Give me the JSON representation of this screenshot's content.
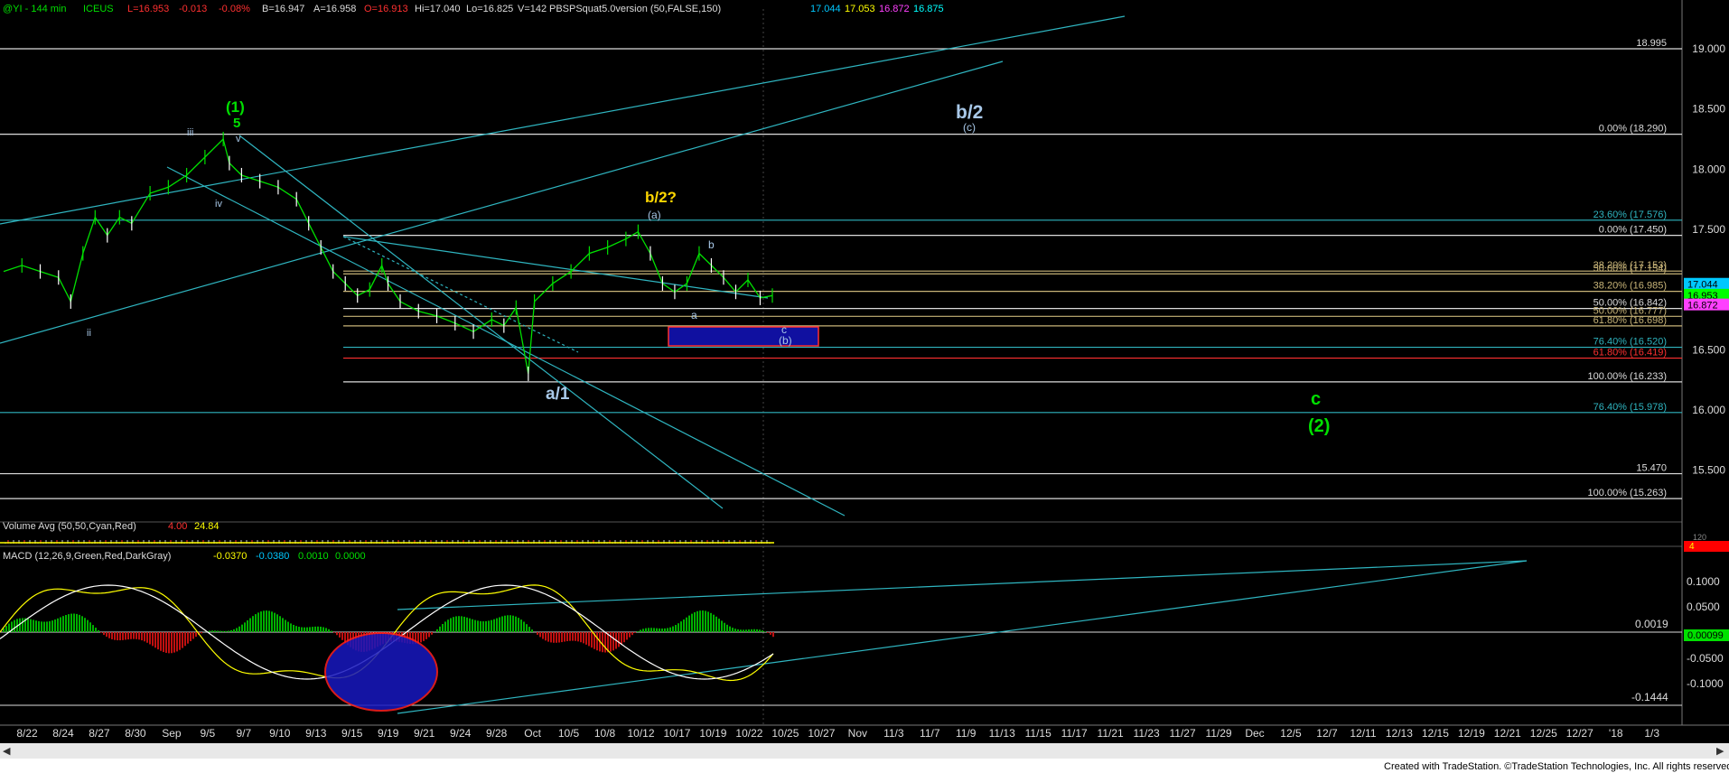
{
  "header": {
    "symbol": "@YI - 144 min",
    "exchange": "ICEUS",
    "last": "L=16.953",
    "change": "-0.013",
    "pct": "-0.08%",
    "bid": "B=16.947",
    "ask": "A=16.958",
    "open": "O=16.913",
    "hi": "Hi=17.040",
    "lo": "Lo=16.825",
    "vol": "V=142",
    "study": "PBSPSquat5.0version (50,FALSE,150)",
    "study_values": [
      "17.044",
      "17.053",
      "16.872",
      "16.875"
    ],
    "study_colors": [
      "#00c8ff",
      "#ffff00",
      "#ff40ff",
      "#00ffff"
    ]
  },
  "volume_panel": {
    "label": "Volume Avg (50,50,Cyan,Red)",
    "v1": "4.00",
    "v2": "24.84",
    "axis_labels": [
      "120",
      "4"
    ]
  },
  "macd_panel": {
    "label": "MACD (12,26,9,Green,Red,DarkGray)",
    "values": [
      "-0.0370",
      "-0.0380",
      "0.0010",
      "0.0000"
    ],
    "axis_labels": [
      "0.1000",
      "0.0500",
      "-0.0500",
      "-0.1000"
    ],
    "current": "0.00099",
    "hline_labels": [
      "0.0019",
      "-0.1444"
    ]
  },
  "footer": {
    "credit": "Created with TradeStation. ©TradeStation Technologies, Inc. All rights reserved."
  },
  "colors": {
    "background": "#000000",
    "grid": "#6e6e6e",
    "channel": "#2fb5c0",
    "bar_up": "#00e000",
    "bar_down": "#ffffff",
    "label_blue": "#a8c8e8",
    "label_green": "#00e000",
    "label_yellow": "#ffd700",
    "box_fill": "#1010a0",
    "box_border": "#ff3030"
  },
  "chart_data": {
    "type": "line",
    "title": "",
    "xlabel": "",
    "ylabel": "",
    "ylim": [
      15.1,
      19.3
    ],
    "x_ticks": [
      "8/22",
      "8/24",
      "8/27",
      "8/30",
      "Sep",
      "9/5",
      "9/7",
      "9/10",
      "9/13",
      "9/15",
      "9/19",
      "9/21",
      "9/24",
      "9/28",
      "Oct",
      "10/5",
      "10/8",
      "10/12",
      "10/17",
      "10/19",
      "10/22",
      "10/25",
      "10/27",
      "Nov",
      "11/3",
      "11/7",
      "11/9",
      "11/13",
      "11/15",
      "11/17",
      "11/21",
      "11/23",
      "11/27",
      "11/29",
      "Dec",
      "12/5",
      "12/7",
      "12/11",
      "12/13",
      "12/15",
      "12/19",
      "12/21",
      "12/25",
      "12/27",
      "'18",
      "1/3"
    ],
    "y_axis_labels": [
      "19.000",
      "18.500",
      "18.000",
      "17.500",
      "16.500",
      "16.000",
      "15.500"
    ],
    "price_series": {
      "name": "@YI",
      "points": [
        [
          0,
          17.15
        ],
        [
          3,
          17.2
        ],
        [
          6,
          17.15
        ],
        [
          9,
          17.1
        ],
        [
          11,
          16.9
        ],
        [
          13,
          17.3
        ],
        [
          15,
          17.6
        ],
        [
          17,
          17.45
        ],
        [
          19,
          17.6
        ],
        [
          21,
          17.55
        ],
        [
          24,
          17.8
        ],
        [
          27,
          17.85
        ],
        [
          30,
          17.95
        ],
        [
          33,
          18.1
        ],
        [
          36,
          18.25
        ],
        [
          37,
          18.05
        ],
        [
          39,
          17.95
        ],
        [
          42,
          17.9
        ],
        [
          45,
          17.85
        ],
        [
          48,
          17.75
        ],
        [
          50,
          17.55
        ],
        [
          52,
          17.35
        ],
        [
          54,
          17.15
        ],
        [
          56,
          17.05
        ],
        [
          58,
          16.95
        ],
        [
          60,
          17.0
        ],
        [
          62,
          17.2
        ],
        [
          63,
          17.05
        ],
        [
          65,
          16.9
        ],
        [
          68,
          16.82
        ],
        [
          71,
          16.78
        ],
        [
          74,
          16.72
        ],
        [
          77,
          16.65
        ],
        [
          80,
          16.75
        ],
        [
          82,
          16.7
        ],
        [
          84,
          16.85
        ],
        [
          86,
          16.3
        ],
        [
          87,
          16.9
        ],
        [
          90,
          17.05
        ],
        [
          93,
          17.15
        ],
        [
          96,
          17.3
        ],
        [
          99,
          17.35
        ],
        [
          102,
          17.42
        ],
        [
          104,
          17.48
        ],
        [
          106,
          17.3
        ],
        [
          108,
          17.05
        ],
        [
          110,
          16.98
        ],
        [
          112,
          17.05
        ],
        [
          114,
          17.3
        ],
        [
          116,
          17.2
        ],
        [
          118,
          17.1
        ],
        [
          120,
          16.98
        ],
        [
          122,
          17.08
        ],
        [
          124,
          16.93
        ],
        [
          126,
          16.95
        ]
      ],
      "x_range": [
        0,
        126
      ]
    },
    "fib_levels": [
      {
        "label": "18.995",
        "value": 19.0,
        "color": "#dcdcdc"
      },
      {
        "label": "0.00% (18.290)",
        "value": 18.29,
        "color": "#dcdcdc"
      },
      {
        "label": "23.60% (17.576)",
        "value": 17.576,
        "color": "#2fb5c0"
      },
      {
        "label": "0.00% (17.450)",
        "value": 17.45,
        "color": "#dcdcdc"
      },
      {
        "label": "38.20% (17.153)",
        "value": 17.153,
        "color": "#c8b478"
      },
      {
        "label": "50.00% (17.154)",
        "value": 17.13,
        "color": "#c8b478"
      },
      {
        "label": "38.20% (16.985)",
        "value": 16.985,
        "color": "#c8b478"
      },
      {
        "label": "50.00% (16.842)",
        "value": 16.842,
        "color": "#dcdcdc"
      },
      {
        "label": "50.00% (16.777)",
        "value": 16.777,
        "color": "#c8b478"
      },
      {
        "label": "61.80% (16.698)",
        "value": 16.698,
        "color": "#c8b478"
      },
      {
        "label": "76.40% (16.520)",
        "value": 16.52,
        "color": "#2fb5c0"
      },
      {
        "label": "61.80% (16.419)",
        "value": 16.43,
        "color": "#ff3030"
      },
      {
        "label": "100.00% (16.233)",
        "value": 16.233,
        "color": "#dcdcdc"
      },
      {
        "label": "76.40% (15.978)",
        "value": 15.978,
        "color": "#2fb5c0"
      },
      {
        "label": "15.470",
        "value": 15.47,
        "color": "#dcdcdc"
      },
      {
        "label": "100.00% (15.263)",
        "value": 15.263,
        "color": "#dcdcdc"
      }
    ],
    "price_tags": [
      {
        "label": "17.044",
        "value": 17.044,
        "color": "#00c8ff"
      },
      {
        "label": "16.953",
        "value": 16.953,
        "color": "#00ff00"
      },
      {
        "label": "16.872",
        "value": 16.872,
        "color": "#ff40ff"
      }
    ],
    "annotations": [
      {
        "text": "(1)",
        "color": "#00e000"
      },
      {
        "text": "5",
        "color": "#00e000"
      },
      {
        "text": "iii",
        "color": "#a8c8e8"
      },
      {
        "text": "iv",
        "color": "#a8c8e8"
      },
      {
        "text": "v",
        "color": "#a8c8e8"
      },
      {
        "text": "ii",
        "color": "#a8c8e8"
      },
      {
        "text": "a/1",
        "color": "#a8c8e8"
      },
      {
        "text": "b/2?",
        "color": "#ffd700"
      },
      {
        "text": "(a)",
        "color": "#a8c8e8"
      },
      {
        "text": "b",
        "color": "#a8c8e8"
      },
      {
        "text": "a",
        "color": "#a8c8e8"
      },
      {
        "text": "c",
        "color": "#a8c8e8"
      },
      {
        "text": "(b)",
        "color": "#a8c8e8"
      },
      {
        "text": "b/2",
        "color": "#a8c8e8"
      },
      {
        "text": "(c)",
        "color": "#a8c8e8"
      },
      {
        "text": "c",
        "color": "#00e000"
      },
      {
        "text": "(2)",
        "color": "#00e000"
      }
    ]
  }
}
